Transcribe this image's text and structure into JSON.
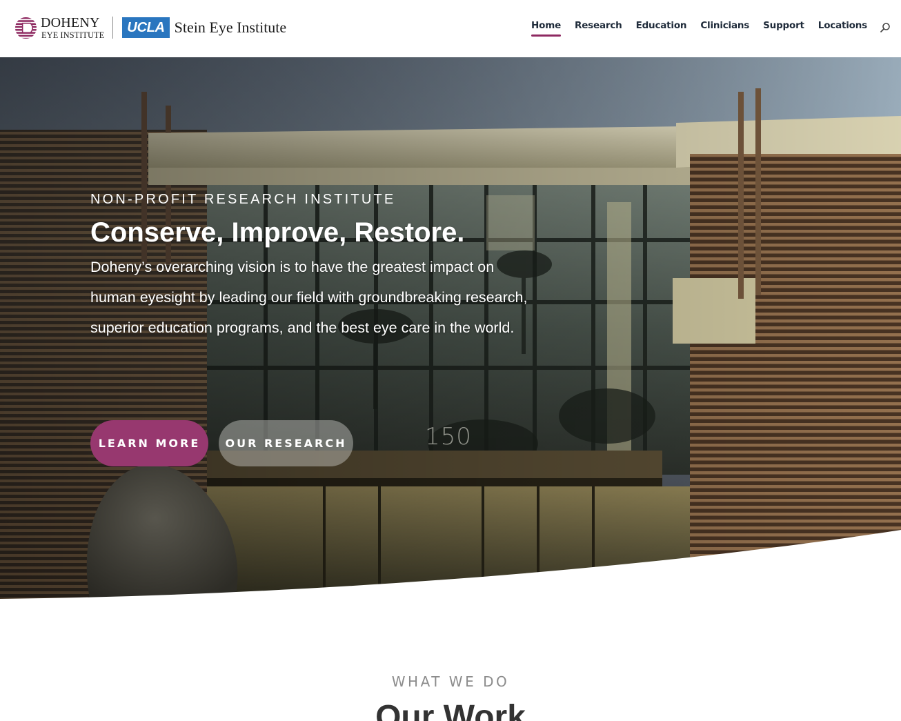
{
  "header": {
    "logo": {
      "doheny_name": "DOHENY",
      "doheny_sub": "EYE INSTITUTE",
      "ucla_label": "UCLA",
      "stein_label": "Stein Eye Institute"
    },
    "nav": [
      {
        "label": "Home",
        "active": true
      },
      {
        "label": "Research",
        "active": false
      },
      {
        "label": "Education",
        "active": false
      },
      {
        "label": "Clinicians",
        "active": false
      },
      {
        "label": "Support",
        "active": false
      },
      {
        "label": "Locations",
        "active": false
      }
    ],
    "search_icon": "search-icon",
    "accent_color": "#8e2961"
  },
  "hero": {
    "eyebrow": "NON-PROFIT RESEARCH INSTITUTE",
    "title": "Conserve, Improve, Restore.",
    "description": "Doheny’s overarching vision is to have the greatest impact on human eyesight by leading our field with groundbreaking research, superior education programs, and the best eye care in the world.",
    "building_sign": "150",
    "buttons": {
      "learn_more": "LEARN MORE",
      "our_research": "OUR RESEARCH"
    },
    "learn_more_color": "#97386f"
  },
  "what_we_do": {
    "eyebrow": "WHAT WE DO",
    "title": "Our Work"
  }
}
